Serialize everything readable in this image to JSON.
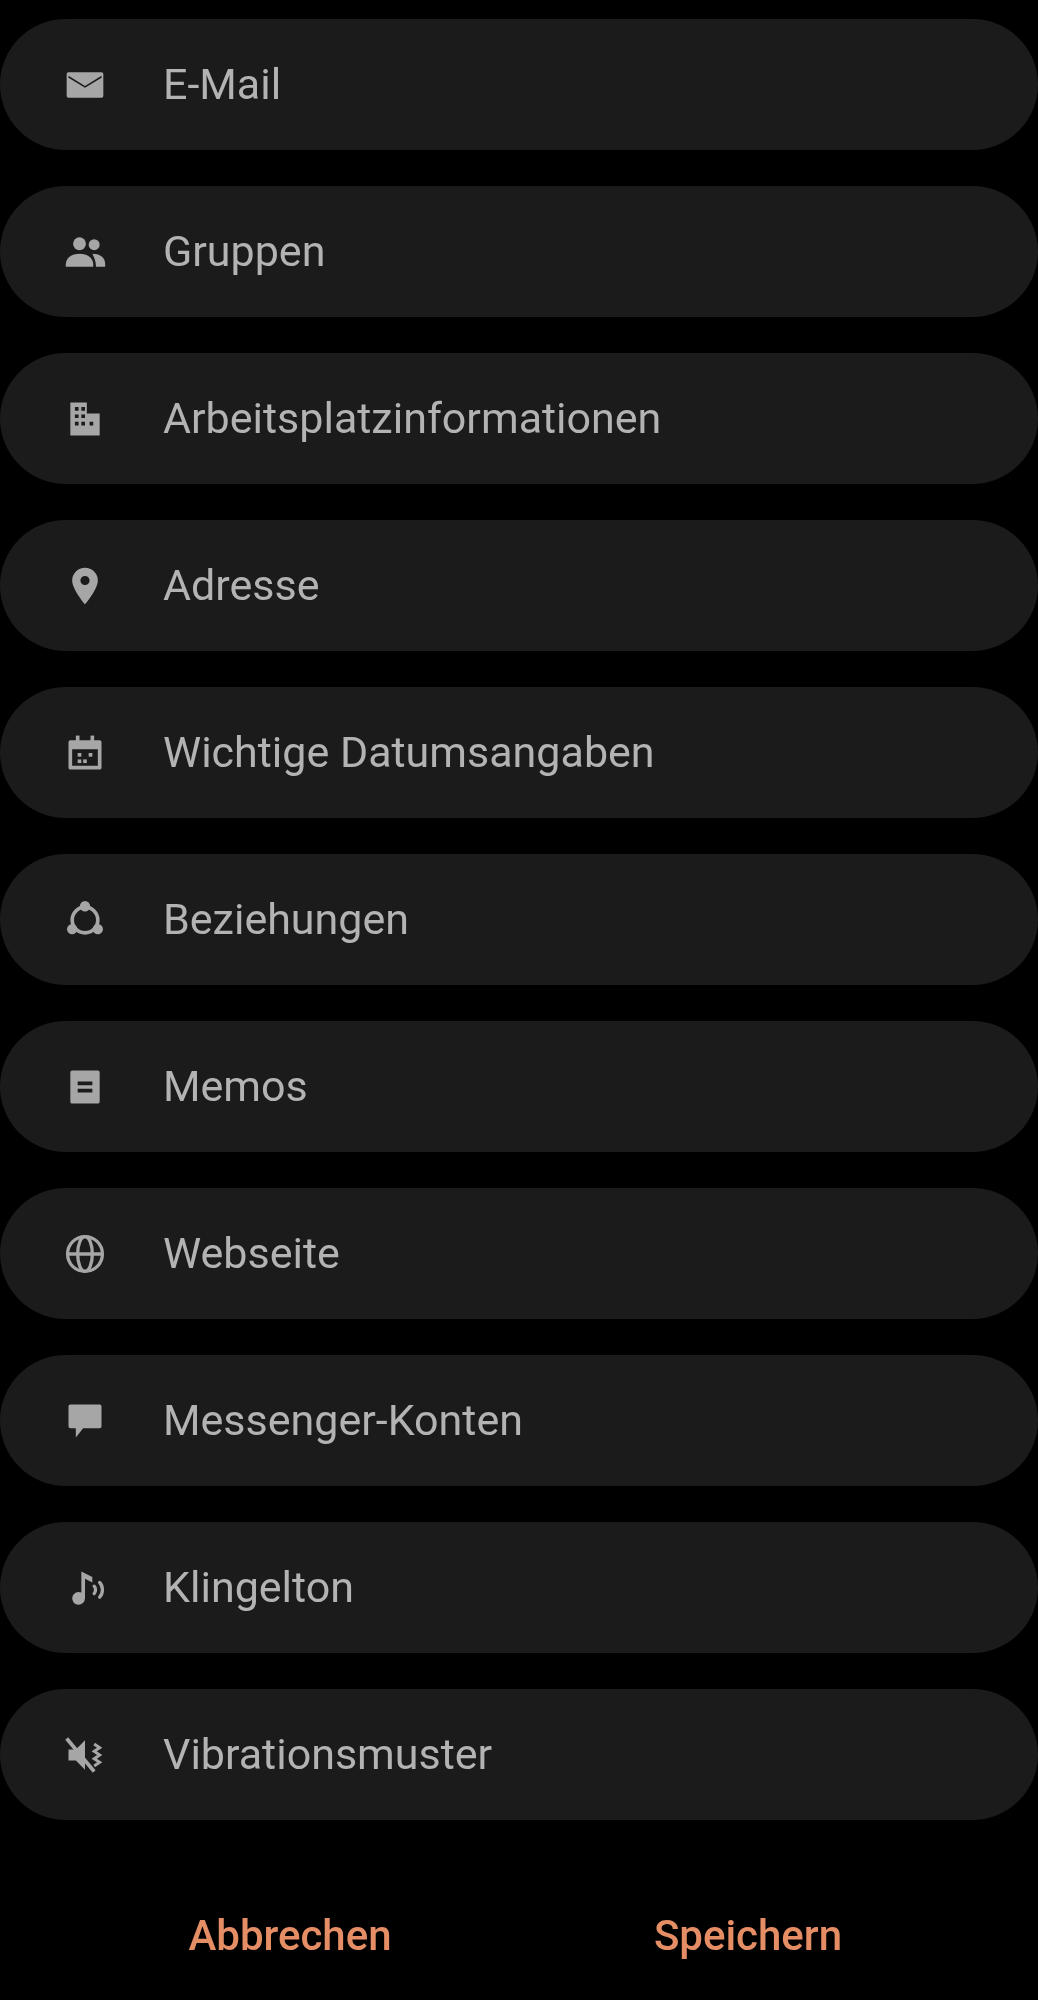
{
  "fields": [
    {
      "label": "E-Mail",
      "kind": "mail"
    },
    {
      "label": "Gruppen",
      "kind": "people"
    },
    {
      "label": "Arbeitsplatzinformationen",
      "kind": "building"
    },
    {
      "label": "Adresse",
      "kind": "pin"
    },
    {
      "label": "Wichtige Datumsangaben",
      "kind": "calendar"
    },
    {
      "label": "Beziehungen",
      "kind": "relations"
    },
    {
      "label": "Memos",
      "kind": "memo"
    },
    {
      "label": "Webseite",
      "kind": "globe"
    },
    {
      "label": "Messenger-Konten",
      "kind": "chat"
    },
    {
      "label": "Klingelton",
      "kind": "ringtone"
    },
    {
      "label": "Vibrationsmuster",
      "kind": "vibrate"
    }
  ],
  "buttons": [
    "Abbrechen",
    "Speichern"
  ]
}
